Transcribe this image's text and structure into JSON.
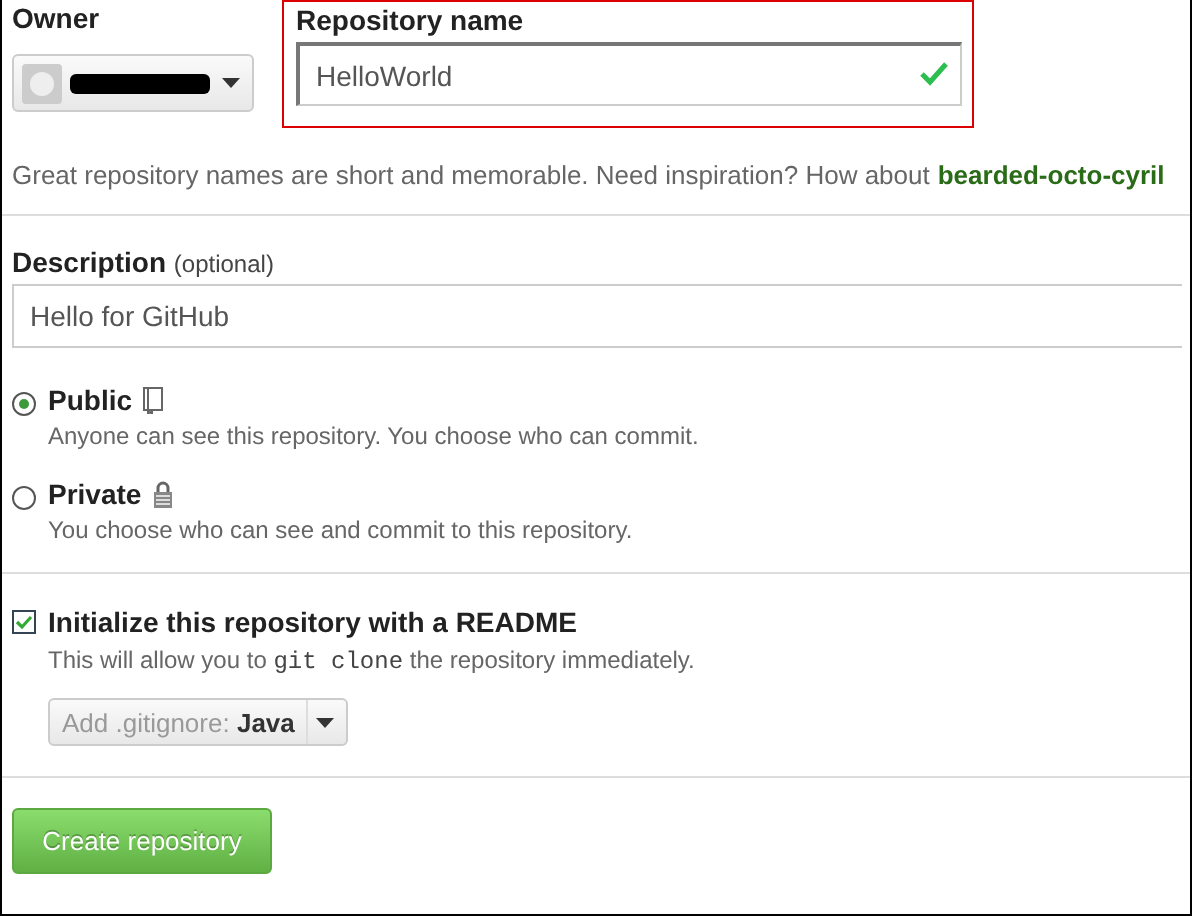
{
  "owner": {
    "label": "Owner"
  },
  "repository_name": {
    "label": "Repository name",
    "value": "HelloWorld",
    "valid": true
  },
  "hint": {
    "text": "Great repository names are short and memorable. Need inspiration? How about",
    "suggestion": "bearded-octo-cyril"
  },
  "description": {
    "label": "Description",
    "note": "(optional)",
    "value": "Hello for GitHub"
  },
  "visibility": [
    {
      "kind": "book",
      "label": "Public",
      "description": "Anyone can see this repository. You choose who can commit.",
      "selected": true
    },
    {
      "kind": "lock",
      "label": "Private",
      "description": "You choose who can see and commit to this repository.",
      "selected": false
    }
  ],
  "readme": {
    "label": "Initialize this repository with a README",
    "checked": true,
    "before": "This will allow you to",
    "code": "git clone",
    "after": "the repository immediately."
  },
  "gitignore": {
    "prefix": "Add .gitignore:",
    "value": "Java"
  },
  "button": "Create repository"
}
